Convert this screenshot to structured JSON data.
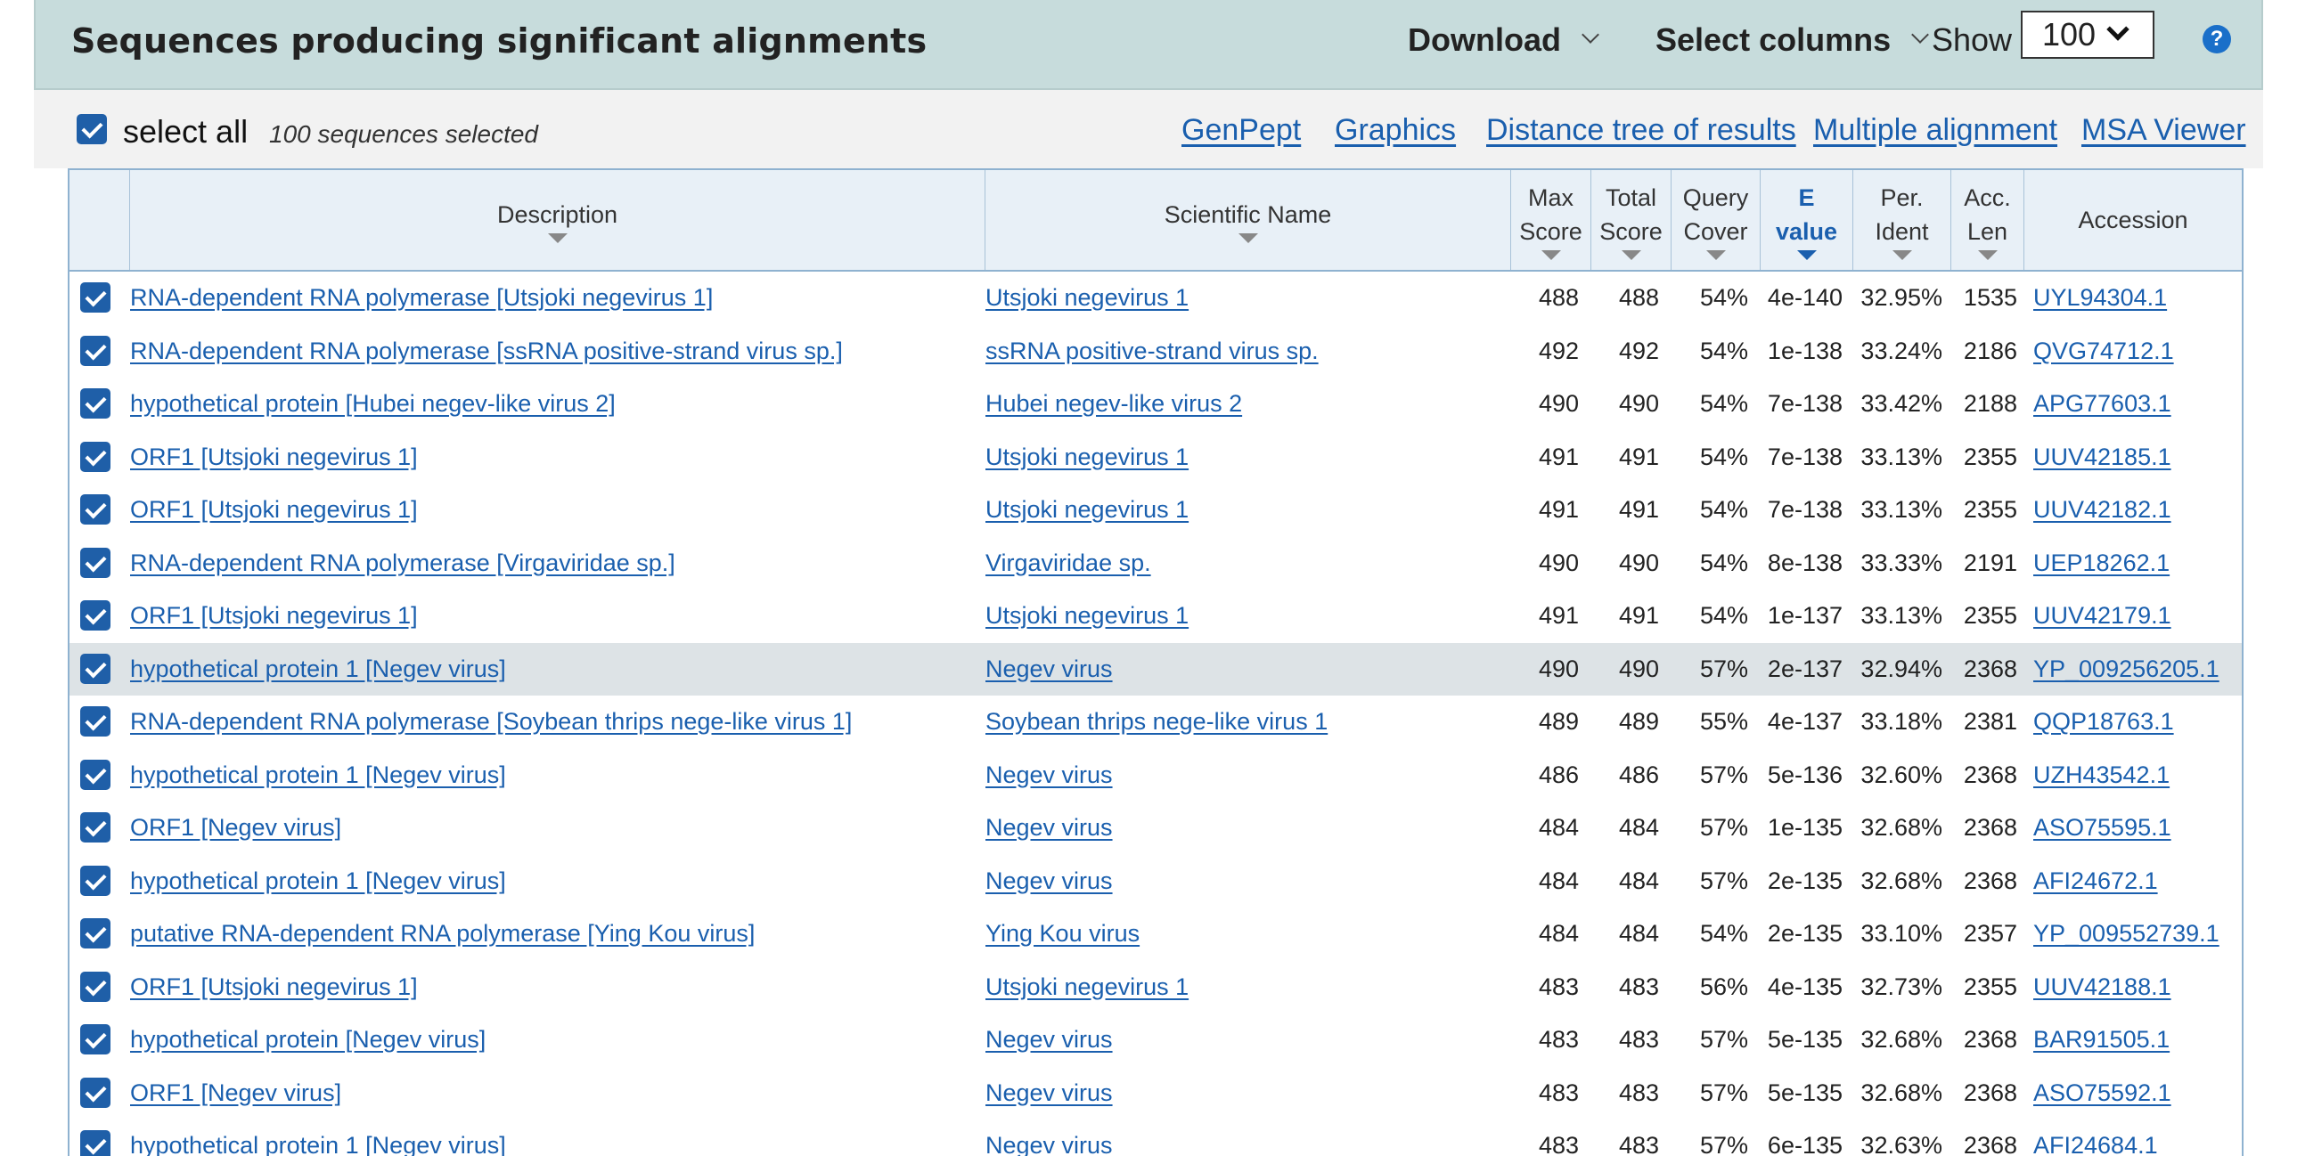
{
  "header": {
    "title": "Sequences producing significant alignments",
    "download_label": "Download",
    "select_columns_label": "Select columns",
    "show_label": "Show",
    "show_value": "100",
    "help_icon": "question-circle-icon",
    "help_glyph": "?"
  },
  "toolbar": {
    "select_all_label": "select all",
    "selected_count": "100 sequences selected",
    "links": [
      "GenPept",
      "Graphics",
      "Distance tree of results",
      "Multiple alignment",
      "MSA Viewer"
    ]
  },
  "table": {
    "columns": {
      "description": "Description",
      "scientific_name": "Scientific Name",
      "max_score": [
        "Max",
        "Score"
      ],
      "total_score": [
        "Total",
        "Score"
      ],
      "query_cover": [
        "Query",
        "Cover"
      ],
      "e_value": [
        "E",
        "value"
      ],
      "per_ident": [
        "Per.",
        "Ident"
      ],
      "acc_len": [
        "Acc.",
        "Len"
      ],
      "accession": "Accession"
    },
    "rows": [
      {
        "description": "RNA-dependent RNA polymerase [Utsjoki negevirus 1]",
        "scientific_name": "Utsjoki negevirus 1",
        "max_score": "488",
        "total_score": "488",
        "query_cover": "54%",
        "e_value": "4e-140",
        "per_ident": "32.95%",
        "acc_len": "1535",
        "accession": "UYL94304.1"
      },
      {
        "description": "RNA-dependent RNA polymerase [ssRNA positive-strand virus sp.]",
        "scientific_name": "ssRNA positive-strand virus sp.",
        "max_score": "492",
        "total_score": "492",
        "query_cover": "54%",
        "e_value": "1e-138",
        "per_ident": "33.24%",
        "acc_len": "2186",
        "accession": "QVG74712.1"
      },
      {
        "description": "hypothetical protein [Hubei negev-like virus 2]",
        "scientific_name": "Hubei negev-like virus 2",
        "max_score": "490",
        "total_score": "490",
        "query_cover": "54%",
        "e_value": "7e-138",
        "per_ident": "33.42%",
        "acc_len": "2188",
        "accession": "APG77603.1"
      },
      {
        "description": "ORF1 [Utsjoki negevirus 1]",
        "scientific_name": "Utsjoki negevirus 1",
        "max_score": "491",
        "total_score": "491",
        "query_cover": "54%",
        "e_value": "7e-138",
        "per_ident": "33.13%",
        "acc_len": "2355",
        "accession": "UUV42185.1"
      },
      {
        "description": "ORF1 [Utsjoki negevirus 1]",
        "scientific_name": "Utsjoki negevirus 1",
        "max_score": "491",
        "total_score": "491",
        "query_cover": "54%",
        "e_value": "7e-138",
        "per_ident": "33.13%",
        "acc_len": "2355",
        "accession": "UUV42182.1"
      },
      {
        "description": "RNA-dependent RNA polymerase [Virgaviridae sp.]",
        "scientific_name": "Virgaviridae sp.",
        "max_score": "490",
        "total_score": "490",
        "query_cover": "54%",
        "e_value": "8e-138",
        "per_ident": "33.33%",
        "acc_len": "2191",
        "accession": "UEP18262.1"
      },
      {
        "description": "ORF1 [Utsjoki negevirus 1]",
        "scientific_name": "Utsjoki negevirus 1",
        "max_score": "491",
        "total_score": "491",
        "query_cover": "54%",
        "e_value": "1e-137",
        "per_ident": "33.13%",
        "acc_len": "2355",
        "accession": "UUV42179.1"
      },
      {
        "description": "hypothetical protein 1 [Negev virus]",
        "scientific_name": "Negev virus",
        "max_score": "490",
        "total_score": "490",
        "query_cover": "57%",
        "e_value": "2e-137",
        "per_ident": "32.94%",
        "acc_len": "2368",
        "accession": "YP_009256205.1",
        "highlighted": true
      },
      {
        "description": "RNA-dependent RNA polymerase [Soybean thrips nege-like virus 1]",
        "scientific_name": "Soybean thrips nege-like virus 1",
        "max_score": "489",
        "total_score": "489",
        "query_cover": "55%",
        "e_value": "4e-137",
        "per_ident": "33.18%",
        "acc_len": "2381",
        "accession": "QQP18763.1"
      },
      {
        "description": "hypothetical protein 1 [Negev virus]",
        "scientific_name": "Negev virus",
        "max_score": "486",
        "total_score": "486",
        "query_cover": "57%",
        "e_value": "5e-136",
        "per_ident": "32.60%",
        "acc_len": "2368",
        "accession": "UZH43542.1"
      },
      {
        "description": "ORF1 [Negev virus]",
        "scientific_name": "Negev virus",
        "max_score": "484",
        "total_score": "484",
        "query_cover": "57%",
        "e_value": "1e-135",
        "per_ident": "32.68%",
        "acc_len": "2368",
        "accession": "ASO75595.1"
      },
      {
        "description": "hypothetical protein 1 [Negev virus]",
        "scientific_name": "Negev virus",
        "max_score": "484",
        "total_score": "484",
        "query_cover": "57%",
        "e_value": "2e-135",
        "per_ident": "32.68%",
        "acc_len": "2368",
        "accession": "AFI24672.1"
      },
      {
        "description": "putative RNA-dependent RNA polymerase [Ying Kou virus]",
        "scientific_name": "Ying Kou virus",
        "max_score": "484",
        "total_score": "484",
        "query_cover": "54%",
        "e_value": "2e-135",
        "per_ident": "33.10%",
        "acc_len": "2357",
        "accession": "YP_009552739.1"
      },
      {
        "description": "ORF1 [Utsjoki negevirus 1]",
        "scientific_name": "Utsjoki negevirus 1",
        "max_score": "483",
        "total_score": "483",
        "query_cover": "56%",
        "e_value": "4e-135",
        "per_ident": "32.73%",
        "acc_len": "2355",
        "accession": "UUV42188.1"
      },
      {
        "description": "hypothetical protein [Negev virus]",
        "scientific_name": "Negev virus",
        "max_score": "483",
        "total_score": "483",
        "query_cover": "57%",
        "e_value": "5e-135",
        "per_ident": "32.68%",
        "acc_len": "2368",
        "accession": "BAR91505.1"
      },
      {
        "description": "ORF1 [Negev virus]",
        "scientific_name": "Negev virus",
        "max_score": "483",
        "total_score": "483",
        "query_cover": "57%",
        "e_value": "5e-135",
        "per_ident": "32.68%",
        "acc_len": "2368",
        "accession": "ASO75592.1"
      },
      {
        "description": "hypothetical protein 1 [Negev virus]",
        "scientific_name": "Negev virus",
        "max_score": "483",
        "total_score": "483",
        "query_cover": "57%",
        "e_value": "6e-135",
        "per_ident": "32.63%",
        "acc_len": "2368",
        "accession": "AFI24684.1"
      }
    ]
  },
  "colors": {
    "header_bg": "#c7dcdc",
    "link": "#1a5fae",
    "checkbox": "#1f5fa8",
    "row_highlight": "#dde3e6"
  }
}
